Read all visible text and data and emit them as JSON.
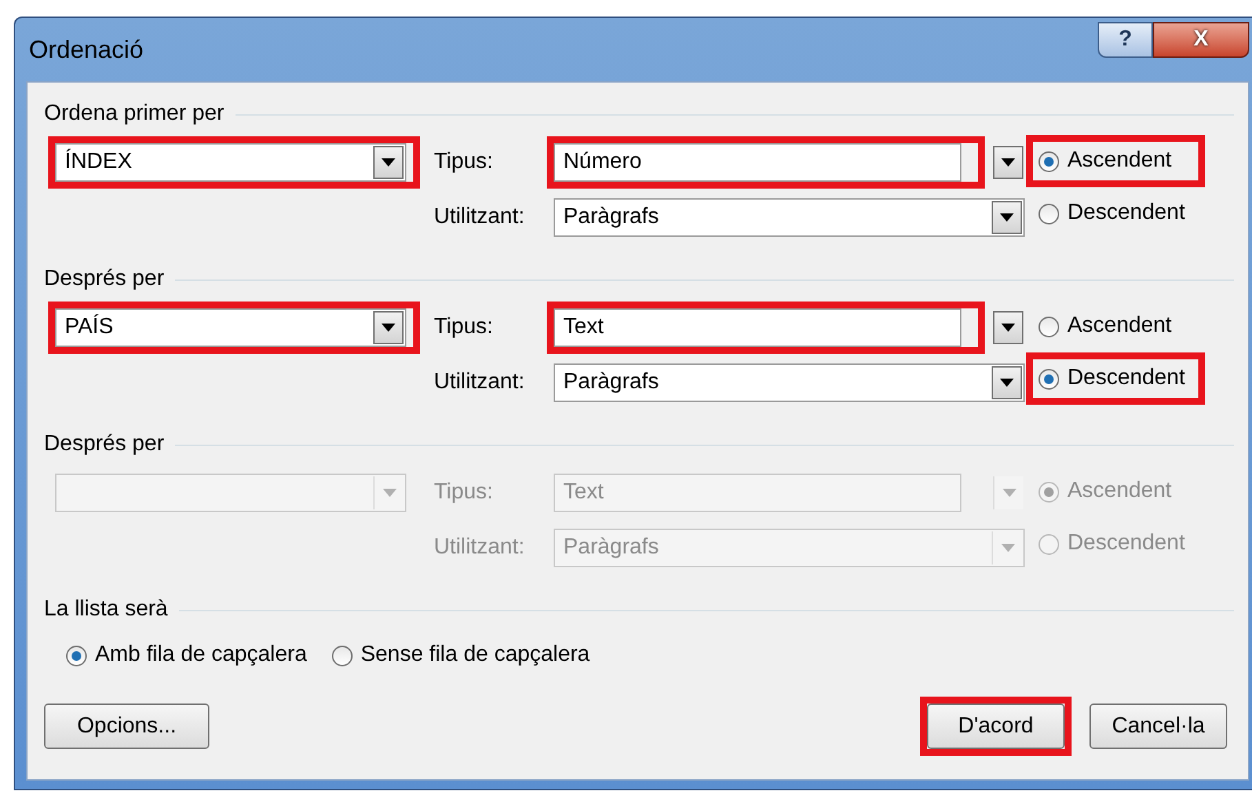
{
  "window": {
    "title": "Ordenació",
    "help": "?",
    "close": "X"
  },
  "groups": [
    {
      "title": "Ordena primer per",
      "disabled": false,
      "key": {
        "value": "ÍNDEX",
        "highlighted": true
      },
      "type_label": "Tipus:",
      "type": {
        "value": "Número",
        "highlighted": true
      },
      "using_label": "Utilitzant:",
      "using": {
        "value": "Paràgrafs"
      },
      "radios": [
        {
          "label": "Ascendent",
          "selected": true,
          "highlighted": true
        },
        {
          "label": "Descendent",
          "selected": false,
          "highlighted": false
        }
      ]
    },
    {
      "title": "Després per",
      "disabled": false,
      "key": {
        "value": "PAÍS",
        "highlighted": true
      },
      "type_label": "Tipus:",
      "type": {
        "value": "Text",
        "highlighted": true
      },
      "using_label": "Utilitzant:",
      "using": {
        "value": "Paràgrafs"
      },
      "radios": [
        {
          "label": "Ascendent",
          "selected": false,
          "highlighted": false
        },
        {
          "label": "Descendent",
          "selected": true,
          "highlighted": true
        }
      ]
    },
    {
      "title": "Després per",
      "disabled": true,
      "key": {
        "highlighted": false
      },
      "type_label": "Tipus:",
      "type": {
        "value": "Text",
        "highlighted": false
      },
      "using_label": "Utilitzant:",
      "using": {
        "value": "Paràgrafs"
      },
      "radios": [
        {
          "label": "Ascendent",
          "selected": true,
          "highlighted": false
        },
        {
          "label": "Descendent",
          "selected": false,
          "highlighted": false
        }
      ]
    }
  ],
  "list": {
    "title": "La llista serà",
    "options": [
      {
        "label": "Amb fila de capçalera",
        "selected": true
      },
      {
        "label": "Sense fila de capçalera",
        "selected": false
      }
    ]
  },
  "buttons": [
    {
      "label": "Opcions...",
      "highlighted": false
    },
    {
      "label": "D'acord",
      "highlighted": true
    },
    {
      "label": "Cancel·la",
      "highlighted": false
    }
  ]
}
